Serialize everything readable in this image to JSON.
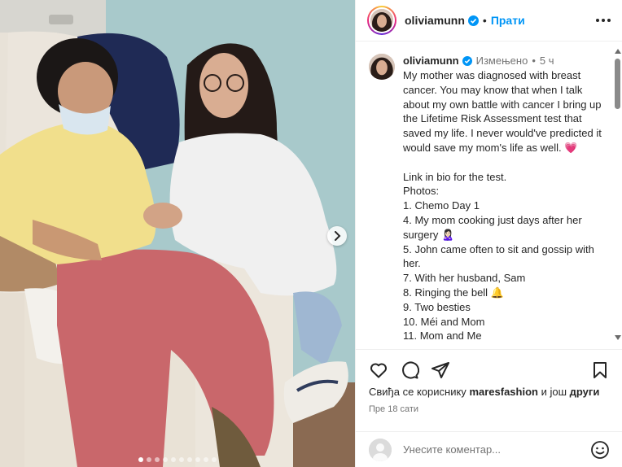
{
  "post": {
    "username": "oliviamunn",
    "follow_label": "Прати",
    "separator": "•",
    "edited_label": "Измењено",
    "age": "5 ч",
    "caption": "My mother was diagnosed with breast cancer. You may know that when I talk about my own battle with cancer I bring up the Lifetime Risk Assessment test that saved my life. I never would've predicted it would save my mom's life as well. 💗\n\nLink in bio for the test.\nPhotos:\n1. Chemo Day 1\n4. My mom cooking just days after her surgery 🙎🏻‍♀️\n5. John came often to sit and gossip with her.\n7. With her husband, Sam\n8. Ringing the bell 🔔\n9. Two besties\n10. Méi and Mom\n11. Mom and Me"
  },
  "engagement": {
    "likes_prefix": "Свиђа се кориснику",
    "liker": "maresfashion",
    "likes_joiner": "и још",
    "likes_suffix": "други",
    "timestamp": "Пре 18 сати"
  },
  "comment": {
    "placeholder": "Унесите коментар..."
  },
  "carousel": {
    "dot_count": 10,
    "active_index": 0
  },
  "icons": {
    "verified": "verified-badge-icon",
    "like": "heart-icon",
    "comment": "comment-icon",
    "share": "share-icon",
    "save": "bookmark-icon",
    "more": "more-options-icon",
    "next": "chevron-right-icon",
    "emoji": "emoji-icon"
  },
  "colors": {
    "accent": "#0095f6",
    "text": "#262626",
    "muted": "#737373",
    "border": "#efefef",
    "heart_emoji": "#e8457a"
  }
}
